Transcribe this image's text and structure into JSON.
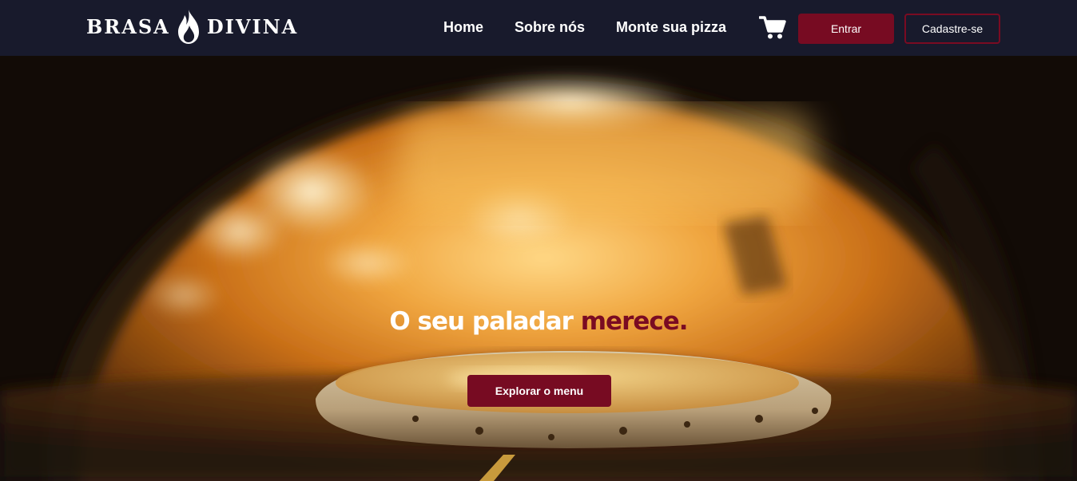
{
  "brand": {
    "name_left": "BRASA",
    "name_right": "DIVINA",
    "icon": "flame-icon"
  },
  "nav": {
    "links": [
      {
        "label": "Home"
      },
      {
        "label": "Sobre nós"
      },
      {
        "label": "Monte sua pizza"
      }
    ],
    "cart_icon": "shopping-cart-icon",
    "login_label": "Entrar",
    "signup_label": "Cadastre-se"
  },
  "hero": {
    "title_main": "O seu paladar",
    "title_accent": "merece.",
    "cta_label": "Explorar o menu",
    "background": "pizza-oven-photo"
  },
  "colors": {
    "navbar_bg": "#181a2c",
    "accent": "#770b22",
    "text": "#ffffff"
  }
}
